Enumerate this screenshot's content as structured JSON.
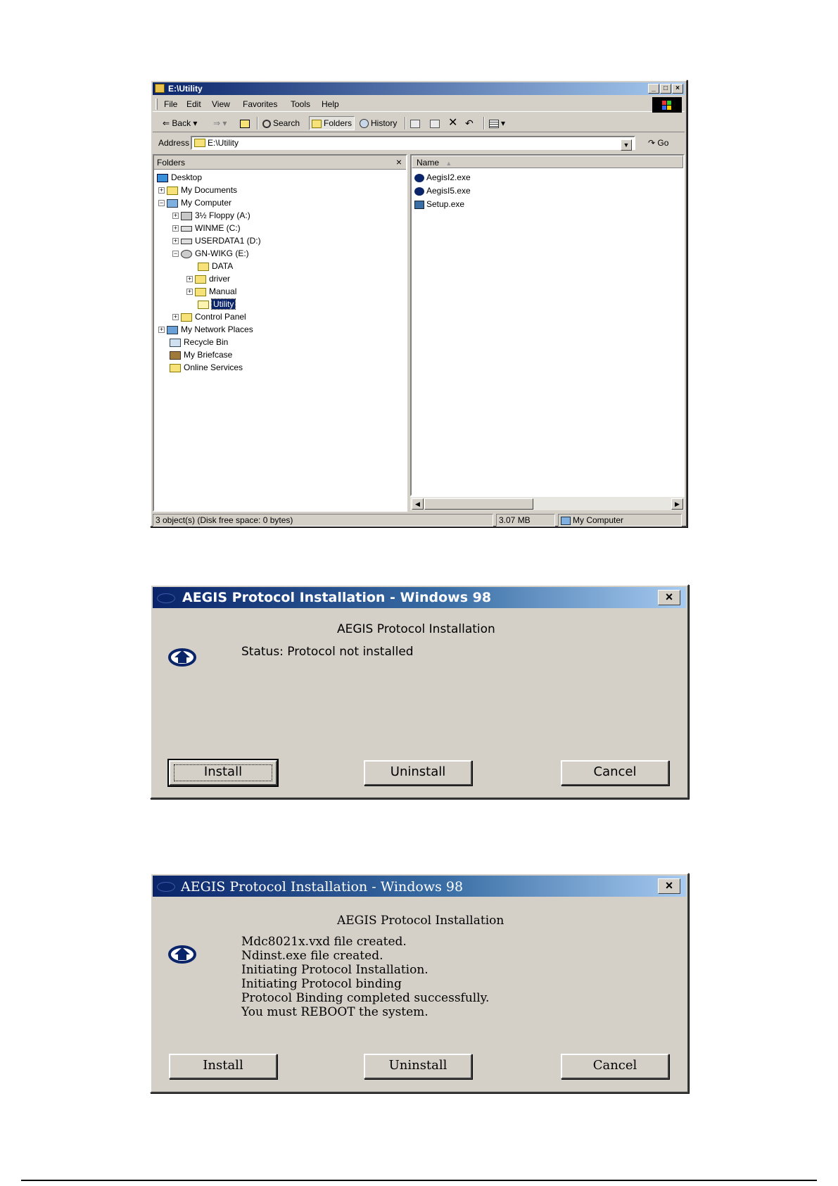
{
  "explorer": {
    "title": "E:\\Utility",
    "caption_buttons": [
      "_",
      "□",
      "×"
    ],
    "menu": [
      "File",
      "Edit",
      "View",
      "Favorites",
      "Tools",
      "Help"
    ],
    "toolbar": {
      "back": "Back",
      "search": "Search",
      "folders": "Folders",
      "history": "History"
    },
    "address": {
      "label": "Address",
      "value": "E:\\Utility",
      "go": "Go"
    },
    "folders_pane": {
      "title": "Folders",
      "close": "×",
      "tree": [
        {
          "label": "Desktop",
          "expander": ""
        },
        {
          "label": "My Documents",
          "expander": "+"
        },
        {
          "label": "My Computer",
          "expander": "−"
        },
        {
          "label": "3½ Floppy (A:)",
          "expander": "+"
        },
        {
          "label": "WINME (C:)",
          "expander": "+"
        },
        {
          "label": "USERDATA1 (D:)",
          "expander": "+"
        },
        {
          "label": "GN-WIKG (E:)",
          "expander": "−"
        },
        {
          "label": "DATA",
          "expander": ""
        },
        {
          "label": "driver",
          "expander": "+"
        },
        {
          "label": "Manual",
          "expander": "+"
        },
        {
          "label": "Utility",
          "expander": ""
        },
        {
          "label": "Control Panel",
          "expander": "+"
        },
        {
          "label": "My Network Places",
          "expander": "+"
        },
        {
          "label": "Recycle Bin",
          "expander": ""
        },
        {
          "label": "My Briefcase",
          "expander": ""
        },
        {
          "label": "Online Services",
          "expander": ""
        }
      ]
    },
    "files_pane": {
      "column": "Name",
      "sort_indicator": "▲",
      "files": [
        "AegisI2.exe",
        "AegisI5.exe",
        "Setup.exe"
      ]
    },
    "status": {
      "objects": "3 object(s) (Disk free space: 0 bytes)",
      "size": "3.07 MB",
      "zone": "My Computer"
    }
  },
  "dialog1": {
    "title": "AEGIS Protocol Installation - Windows 98",
    "heading": "AEGIS Protocol Installation",
    "status": "Status: Protocol not installed",
    "buttons": {
      "install": "Install",
      "uninstall": "Uninstall",
      "cancel": "Cancel"
    },
    "close": "×"
  },
  "dialog2": {
    "title": "AEGIS Protocol Installation - Windows 98",
    "heading": "AEGIS Protocol Installation",
    "messages": [
      "Mdc8021x.vxd file created.",
      "Ndinst.exe file created.",
      "Initiating Protocol Installation.",
      "Initiating Protocol binding",
      "Protocol Binding completed successfully.",
      "You must REBOOT the system."
    ],
    "buttons": {
      "install": "Install",
      "uninstall": "Uninstall",
      "cancel": "Cancel"
    },
    "close": "×"
  },
  "colors": {
    "titlebar_start": "#0a246a",
    "titlebar_end": "#a6caf0",
    "window_face": "#d4d0c8",
    "selection": "#0a246a"
  }
}
